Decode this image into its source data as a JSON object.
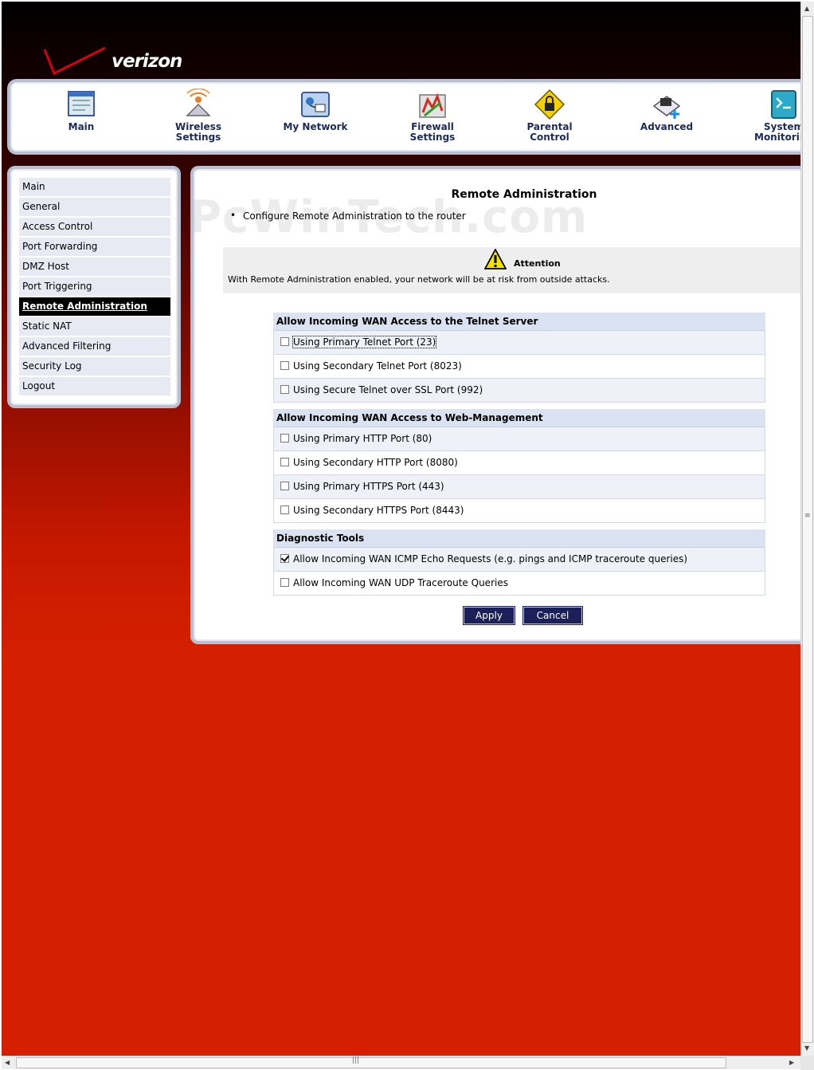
{
  "brand": {
    "logo_text": "verizon"
  },
  "topnav": [
    {
      "label": "Main",
      "icon": "main-icon"
    },
    {
      "label": "Wireless\nSettings",
      "icon": "wireless-icon"
    },
    {
      "label": "My Network",
      "icon": "network-icon"
    },
    {
      "label": "Firewall\nSettings",
      "icon": "firewall-icon"
    },
    {
      "label": "Parental\nControl",
      "icon": "lock-icon"
    },
    {
      "label": "Advanced",
      "icon": "advanced-icon"
    },
    {
      "label": "System\nMonitoring",
      "icon": "monitor-icon"
    }
  ],
  "sidebar": {
    "items": [
      {
        "label": "Main"
      },
      {
        "label": "General"
      },
      {
        "label": "Access Control"
      },
      {
        "label": "Port Forwarding"
      },
      {
        "label": "DMZ Host"
      },
      {
        "label": "Port Triggering"
      },
      {
        "label": "Remote Administration",
        "active": true
      },
      {
        "label": "Static NAT"
      },
      {
        "label": "Advanced Filtering"
      },
      {
        "label": "Security Log"
      },
      {
        "label": "Logout"
      }
    ]
  },
  "watermark": "PcWinTech.com",
  "content": {
    "title": "Remote Administration",
    "intro": "Configure Remote Administration to the router",
    "attention": {
      "title": "Attention",
      "text": "With Remote Administration enabled, your network will be at risk from outside attacks."
    },
    "sections": [
      {
        "title": "Allow Incoming WAN Access to the Telnet Server",
        "options": [
          {
            "label": "Using Primary Telnet Port (23)",
            "checked": false
          },
          {
            "label": "Using Secondary Telnet Port (8023)",
            "checked": false
          },
          {
            "label": "Using Secure Telnet over SSL Port (992)",
            "checked": false
          }
        ]
      },
      {
        "title": "Allow Incoming WAN Access to Web-Management",
        "options": [
          {
            "label": "Using Primary HTTP Port (80)",
            "checked": false
          },
          {
            "label": "Using Secondary HTTP Port (8080)",
            "checked": false
          },
          {
            "label": "Using Primary HTTPS Port (443)",
            "checked": false
          },
          {
            "label": "Using Secondary HTTPS Port (8443)",
            "checked": false
          }
        ]
      },
      {
        "title": "Diagnostic Tools",
        "options": [
          {
            "label": "Allow Incoming WAN ICMP Echo Requests (e.g. pings and ICMP traceroute queries)",
            "checked": true
          },
          {
            "label": "Allow Incoming WAN UDP Traceroute Queries",
            "checked": false
          }
        ]
      }
    ],
    "apply_label": "Apply",
    "cancel_label": "Cancel"
  },
  "colors": {
    "nav_text": "#1c2a5c",
    "button_bg": "#1c2058",
    "section_header": "#dbe2f1",
    "page_red": "#d42000"
  }
}
